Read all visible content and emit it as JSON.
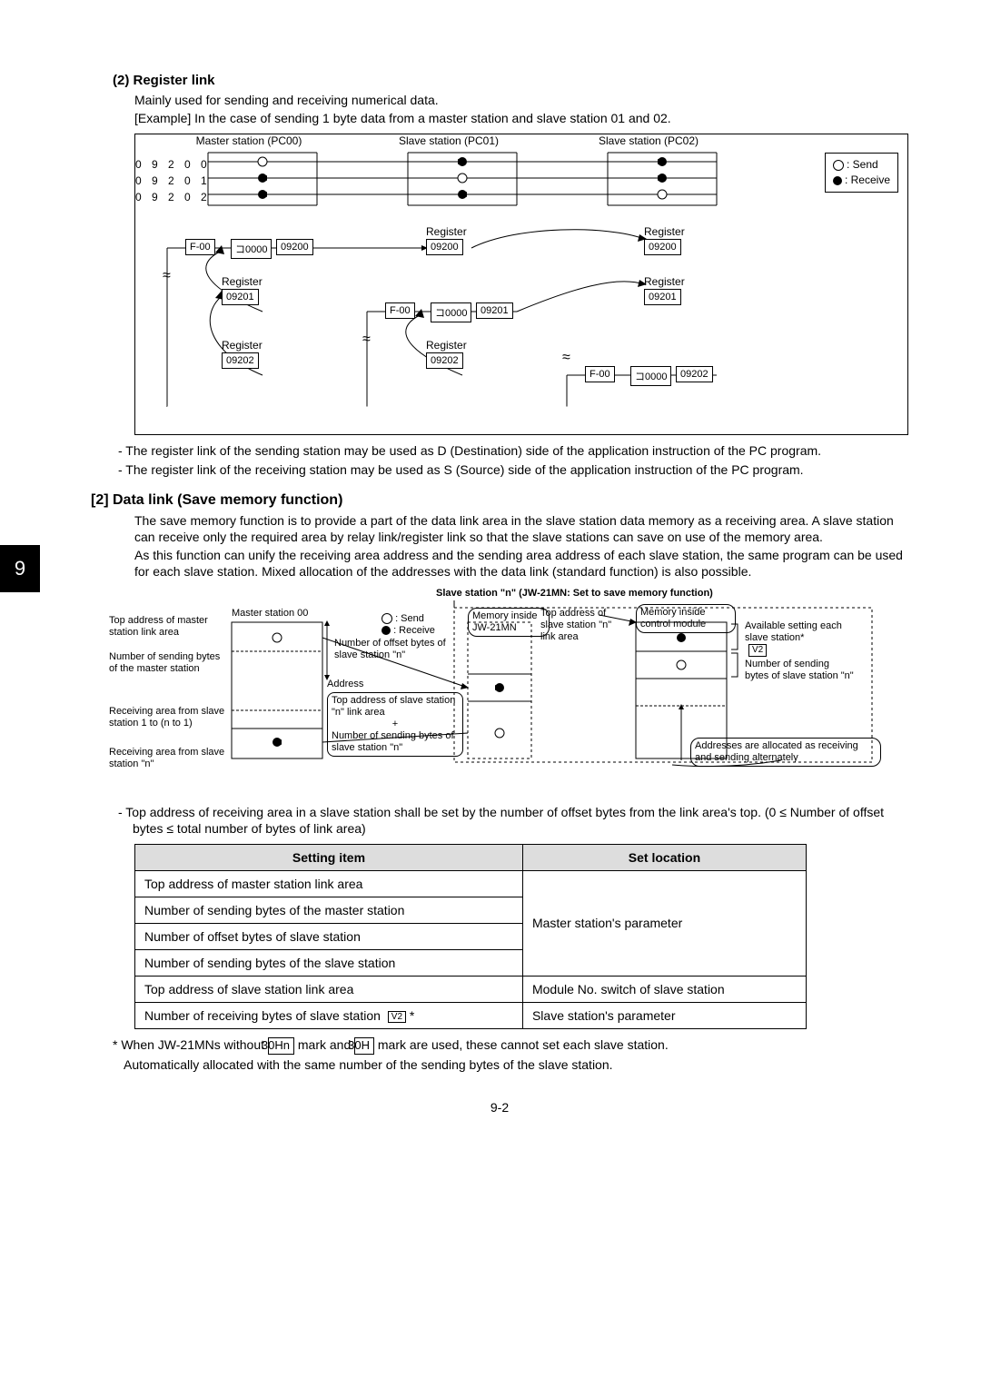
{
  "sideTab": "9",
  "section1": {
    "heading": "(2) Register link",
    "line1": "Mainly used for sending and receiving numerical data.",
    "line2": "[Example] In the case of sending 1 byte data from a master station and slave station 01 and 02."
  },
  "diagram1": {
    "stations": [
      "Master station (PC00)",
      "Slave station (PC01)",
      "Slave station (PC02)"
    ],
    "addresses": [
      "0 9 2 0 0",
      "0 9 2 0 1",
      "0 9 2 0 2"
    ],
    "legend": {
      "send": ": Send",
      "receive": ": Receive"
    },
    "registerLabel": "Register",
    "regVals": [
      "09200",
      "09201",
      "09202"
    ],
    "f00": "F-00",
    "coil": "コ0000"
  },
  "notes1": {
    "n1": "- The register link of the sending station may be used as D (Destination) side of the application instruction of the PC program.",
    "n2": "- The register link of the receiving station may be used as S (Source) side of the application instruction of the PC program."
  },
  "section2": {
    "heading": "[2] Data link (Save memory function)",
    "p1": "The save memory function is to provide a part of the data link area in the slave station data memory as a receiving area. A slave station can receive only the required area by relay link/register link so that the slave stations can save on use of the memory area.",
    "p2": "As this function can unify the receiving area address and the sending area address of each slave station, the same program can be used for each slave station. Mixed allocation of the addresses with the data link (standard function) is also possible."
  },
  "diagram2": {
    "title": "Slave station \"n\"  (JW-21MN: Set to save memory function)",
    "sendLabel": ": Send",
    "receiveLabel": ": Receive",
    "masterTitle": "Master station 00",
    "labels": {
      "topAddrMaster": "Top address of master station link area",
      "numSendMaster": "Number of sending bytes of the master station",
      "recvArea1": "Receiving area from slave station 1 to (n to 1)",
      "recvAreaN": "Receiving area from slave station \"n\"",
      "offsetBytes": "Number of offset bytes of slave station \"n\"",
      "address": "Address",
      "topAddrSlaveN": "Top address of slave station \"n\" link area",
      "plus": "+",
      "numSendSlaveN": "Number of sending bytes of slave station \"n\"",
      "memInside": "Memory inside JW-21MN",
      "topAddrSlave": "Top address of slave station \"n\" link area",
      "memControl": "Memory inside control module",
      "availSetting": "Available setting each slave station*",
      "v2": "V2",
      "numSendBytesSlave": "Number of sending bytes of slave station \"n\"",
      "allocNote": "Addresses are allocated as receiving and sending alternately"
    }
  },
  "note2": "- Top address of receiving area in a slave station shall be set by the number of offset bytes from the link area's top. (0 ≤ Number of offset bytes ≤ total number of bytes of link area)",
  "table": {
    "h1": "Setting item",
    "h2": "Set location",
    "r1": "Top address of master station link area",
    "r2": "Number of sending bytes of the master station",
    "r3": "Number of offset bytes of slave station",
    "r4": "Number of sending bytes of the slave station",
    "loc1": "Master station's parameter",
    "r5": "Top address of slave station link area",
    "loc2": "Module No. switch of slave station",
    "r6": "Number of receiving bytes of slave station",
    "v2": "V2",
    "loc3": "Slave station's parameter"
  },
  "footnote": {
    "f1a": "* When JW-21MNs without ",
    "mark1": "30Hn",
    "f1b": " mark and ",
    "mark2": "30H",
    "f1c": " mark are used, these cannot set each slave station.",
    "f2": "Automatically allocated with the same number of the sending bytes of the slave station."
  },
  "pageNum": "9-2"
}
